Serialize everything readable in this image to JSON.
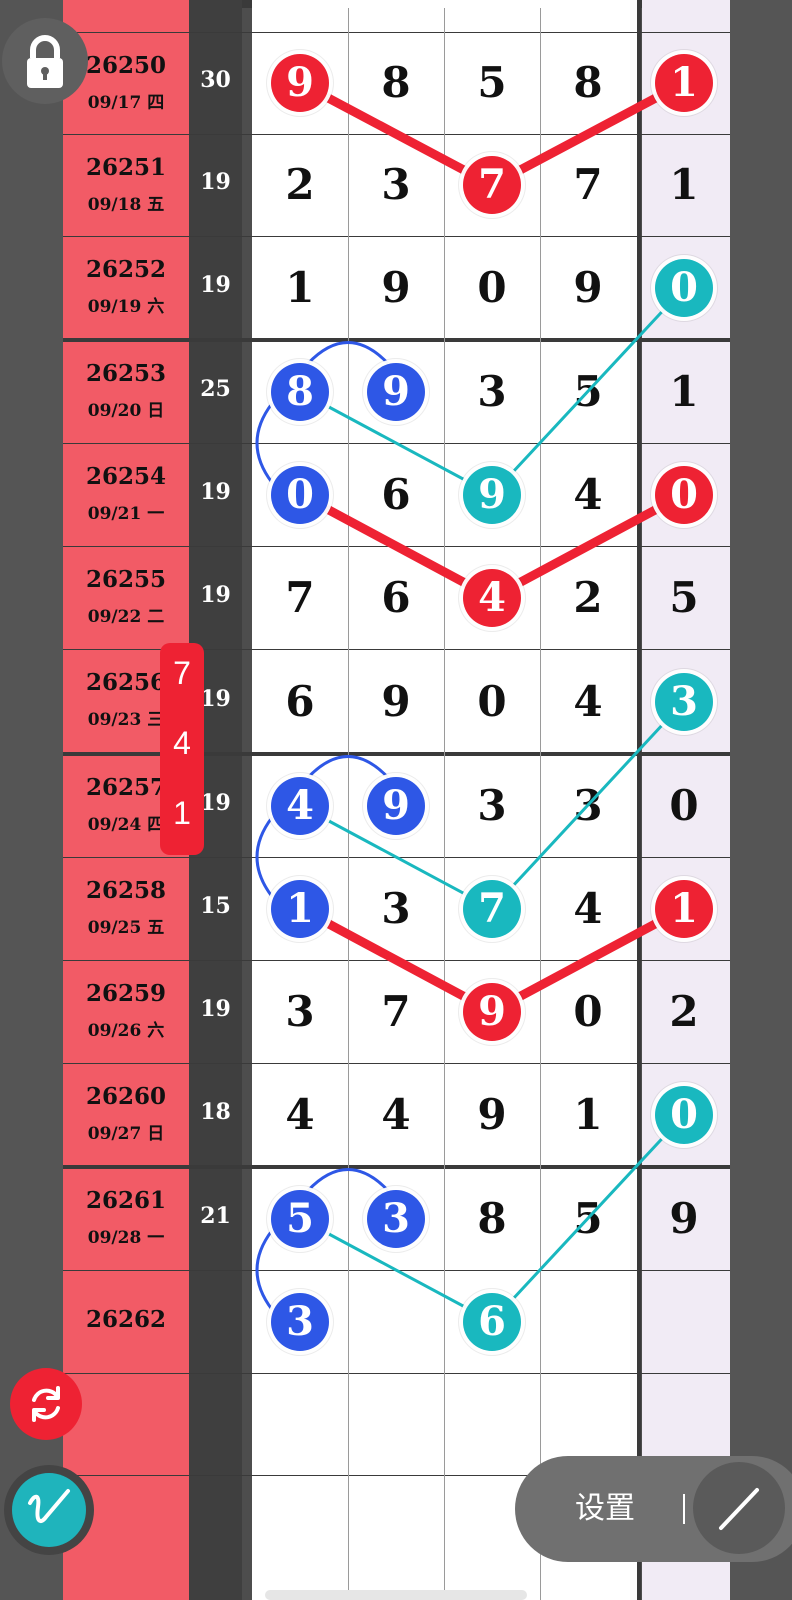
{
  "colors": {
    "red": "#ee2233",
    "blue": "#2e57e6",
    "teal": "#19b8bf",
    "issue_bg": "#f25b66",
    "sum_bg": "#3f3f3f"
  },
  "icons": {
    "lock": "lock-icon",
    "refresh": "refresh-icon",
    "pen": "pen-icon",
    "draw": "line-draw-icon"
  },
  "controls": {
    "settings_label": "设置",
    "badge_digits": [
      "7",
      "4",
      "1"
    ]
  },
  "rows": [
    {
      "issue": "26250",
      "date": "09/17 四",
      "sum": "30",
      "digits": [
        "9",
        "8",
        "5",
        "8",
        "1"
      ]
    },
    {
      "issue": "26251",
      "date": "09/18 五",
      "sum": "19",
      "digits": [
        "2",
        "3",
        "7",
        "7",
        "1"
      ]
    },
    {
      "issue": "26252",
      "date": "09/19 六",
      "sum": "19",
      "digits": [
        "1",
        "9",
        "0",
        "9",
        "0"
      ]
    },
    {
      "issue": "26253",
      "date": "09/20 日",
      "sum": "25",
      "digits": [
        "8",
        "9",
        "3",
        "5",
        "1"
      ]
    },
    {
      "issue": "26254",
      "date": "09/21 一",
      "sum": "19",
      "digits": [
        "0",
        "6",
        "9",
        "4",
        "0"
      ]
    },
    {
      "issue": "26255",
      "date": "09/22 二",
      "sum": "19",
      "digits": [
        "7",
        "6",
        "4",
        "2",
        "5"
      ]
    },
    {
      "issue": "26256",
      "date": "09/23 三",
      "sum": "19",
      "digits": [
        "6",
        "9",
        "0",
        "4",
        "3"
      ]
    },
    {
      "issue": "26257",
      "date": "09/24 四",
      "sum": "19",
      "digits": [
        "4",
        "9",
        "3",
        "3",
        "0"
      ]
    },
    {
      "issue": "26258",
      "date": "09/25 五",
      "sum": "15",
      "digits": [
        "1",
        "3",
        "7",
        "4",
        "1"
      ]
    },
    {
      "issue": "26259",
      "date": "09/26 六",
      "sum": "19",
      "digits": [
        "3",
        "7",
        "9",
        "0",
        "2"
      ]
    },
    {
      "issue": "26260",
      "date": "09/27 日",
      "sum": "18",
      "digits": [
        "4",
        "4",
        "9",
        "1",
        "0"
      ]
    },
    {
      "issue": "26261",
      "date": "09/28 一",
      "sum": "21",
      "digits": [
        "5",
        "3",
        "8",
        "5",
        "9"
      ]
    },
    {
      "issue": "26262",
      "date": "",
      "sum": "",
      "digits": [
        "3",
        "",
        "6",
        "",
        ""
      ]
    }
  ],
  "highlights": [
    {
      "row": 0,
      "col": 0,
      "color": "red"
    },
    {
      "row": 0,
      "col": 4,
      "color": "red"
    },
    {
      "row": 1,
      "col": 2,
      "color": "red"
    },
    {
      "row": 2,
      "col": 4,
      "color": "teal"
    },
    {
      "row": 3,
      "col": 0,
      "color": "blue"
    },
    {
      "row": 3,
      "col": 1,
      "color": "blue"
    },
    {
      "row": 4,
      "col": 0,
      "color": "blue"
    },
    {
      "row": 4,
      "col": 2,
      "color": "teal"
    },
    {
      "row": 4,
      "col": 4,
      "color": "red"
    },
    {
      "row": 5,
      "col": 2,
      "color": "red"
    },
    {
      "row": 6,
      "col": 4,
      "color": "teal"
    },
    {
      "row": 7,
      "col": 0,
      "color": "blue"
    },
    {
      "row": 7,
      "col": 1,
      "color": "blue"
    },
    {
      "row": 8,
      "col": 0,
      "color": "blue"
    },
    {
      "row": 8,
      "col": 2,
      "color": "teal"
    },
    {
      "row": 8,
      "col": 4,
      "color": "red"
    },
    {
      "row": 9,
      "col": 2,
      "color": "red"
    },
    {
      "row": 10,
      "col": 4,
      "color": "teal"
    },
    {
      "row": 11,
      "col": 0,
      "color": "blue"
    },
    {
      "row": 11,
      "col": 1,
      "color": "blue"
    },
    {
      "row": 12,
      "col": 0,
      "color": "blue"
    },
    {
      "row": 12,
      "col": 2,
      "color": "teal"
    }
  ],
  "connectors": [
    {
      "type": "line",
      "color": "red",
      "path": [
        [
          0,
          0
        ],
        [
          1,
          2
        ],
        [
          0,
          4
        ]
      ]
    },
    {
      "type": "line",
      "color": "red",
      "path": [
        [
          4,
          0
        ],
        [
          5,
          2
        ],
        [
          4,
          4
        ]
      ]
    },
    {
      "type": "line",
      "color": "red",
      "path": [
        [
          8,
          0
        ],
        [
          9,
          2
        ],
        [
          8,
          4
        ]
      ]
    },
    {
      "type": "line",
      "color": "teal",
      "path": [
        [
          3,
          0
        ],
        [
          4,
          2
        ],
        [
          2,
          4
        ]
      ]
    },
    {
      "type": "line",
      "color": "teal",
      "path": [
        [
          7,
          0
        ],
        [
          8,
          2
        ],
        [
          6,
          4
        ]
      ]
    },
    {
      "type": "line",
      "color": "teal",
      "path": [
        [
          11,
          0
        ],
        [
          12,
          2
        ],
        [
          10,
          4
        ]
      ]
    },
    {
      "type": "arcTop",
      "color": "blue",
      "from": [
        3,
        0
      ],
      "to": [
        3,
        1
      ]
    },
    {
      "type": "arcLeft",
      "color": "blue",
      "from": [
        3,
        0
      ],
      "to": [
        4,
        0
      ]
    },
    {
      "type": "arcTop",
      "color": "blue",
      "from": [
        7,
        0
      ],
      "to": [
        7,
        1
      ]
    },
    {
      "type": "arcLeft",
      "color": "blue",
      "from": [
        7,
        0
      ],
      "to": [
        8,
        0
      ]
    },
    {
      "type": "arcTop",
      "color": "blue",
      "from": [
        11,
        0
      ],
      "to": [
        11,
        1
      ]
    },
    {
      "type": "arcLeft",
      "color": "blue",
      "from": [
        11,
        0
      ],
      "to": [
        12,
        0
      ]
    }
  ]
}
